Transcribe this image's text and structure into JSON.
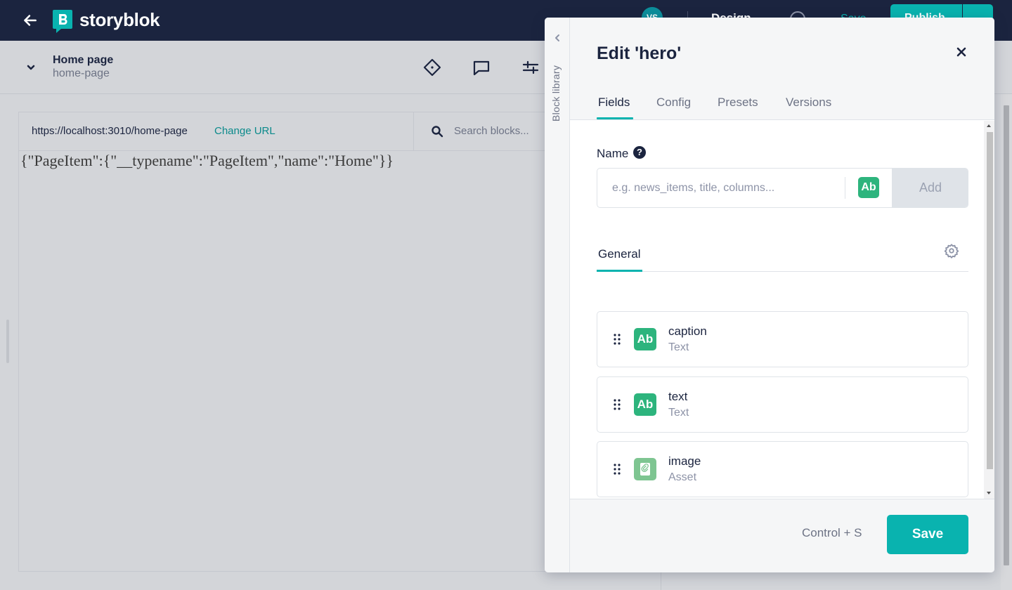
{
  "topbar": {
    "logo_text": "storyblok",
    "avatar_initials": "VS",
    "center_label": "Design",
    "save_link": "Save",
    "publish_label": "Publish"
  },
  "subheader": {
    "story_title": "Home page",
    "story_slug": "home-page"
  },
  "preview": {
    "url": "https://localhost:3010/home-page",
    "change_url_label": "Change URL",
    "search_placeholder": "Search blocks...",
    "json_content": "{\"PageItem\":{\"__typename\":\"PageItem\",\"name\":\"Home\"}}"
  },
  "modal": {
    "block_library_label": "Block library",
    "title": "Edit 'hero'",
    "tabs": [
      {
        "label": "Fields",
        "active": true
      },
      {
        "label": "Config",
        "active": false
      },
      {
        "label": "Presets",
        "active": false
      },
      {
        "label": "Versions",
        "active": false
      }
    ],
    "name_label": "Name",
    "name_info_glyph": "?",
    "name_placeholder": "e.g. news_items, title, columns...",
    "type_badge": "Ab",
    "add_label": "Add",
    "group_tab": "General",
    "fields": [
      {
        "name": "caption",
        "type": "Text",
        "icon": "Ab",
        "icon_kind": "text"
      },
      {
        "name": "text",
        "type": "Text",
        "icon": "Ab",
        "icon_kind": "text"
      },
      {
        "name": "image",
        "type": "Asset",
        "icon": "asset-icon",
        "icon_kind": "asset"
      }
    ],
    "shortcut_hint": "Control + S",
    "save_label": "Save"
  },
  "colors": {
    "topbar": "#1b243f",
    "accent_teal": "#09b3af",
    "text_field_green": "#2db47d",
    "asset_green": "#7ec591"
  }
}
